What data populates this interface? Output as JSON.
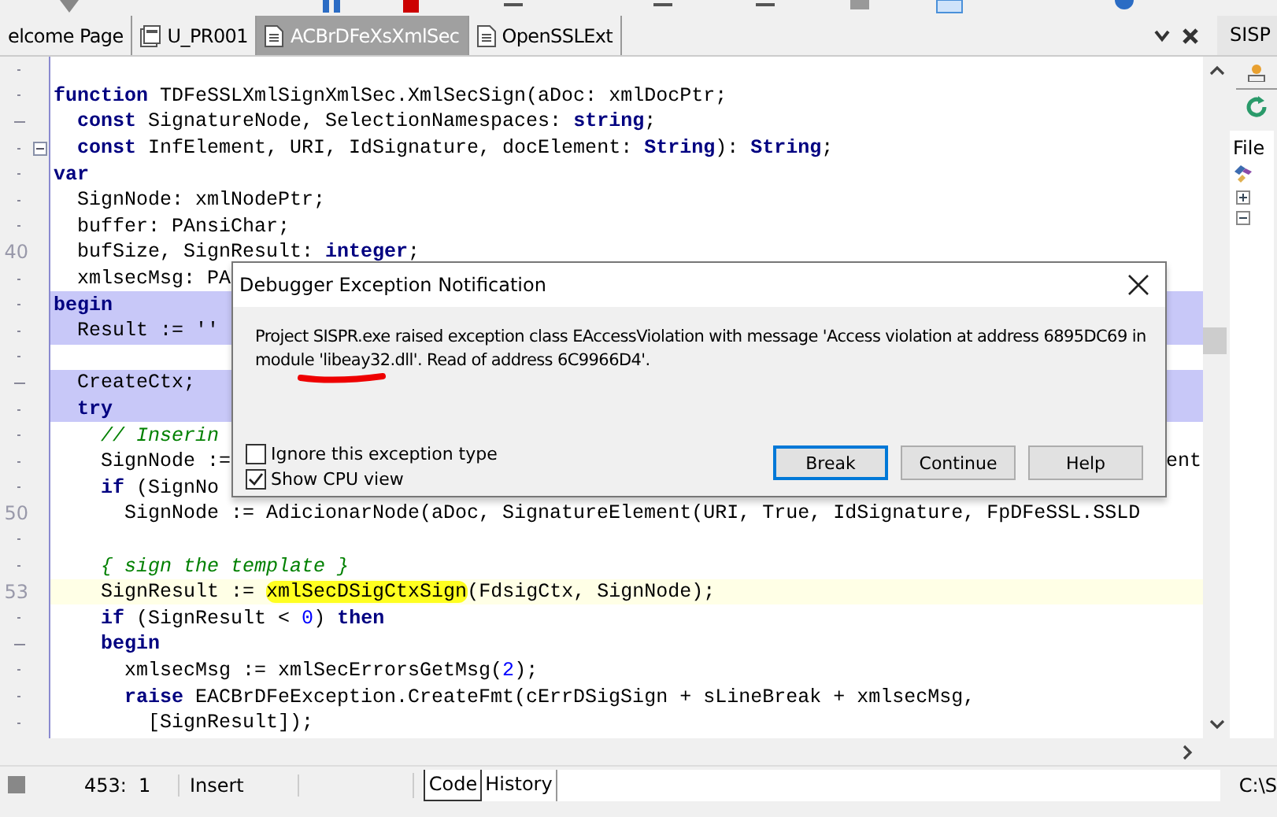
{
  "editor_tabs": [
    {
      "label": "elcome Page",
      "kind": "plain",
      "selected": false
    },
    {
      "label": "U_PR001",
      "kind": "form",
      "selected": false
    },
    {
      "label": "ACBrDFeXsXmlSec",
      "kind": "unit",
      "selected": true
    },
    {
      "label": "OpenSSLExt",
      "kind": "unit",
      "selected": false
    }
  ],
  "side_panel": {
    "title": "SISP",
    "tab_label": "File"
  },
  "code_lines": [
    {
      "gutter": {
        "kind": "dot"
      },
      "fold_box": false,
      "highlighted": false,
      "current": false
    },
    {
      "gutter": {
        "kind": "dot"
      },
      "fold_box": false,
      "highlighted": false,
      "current": false,
      "segments": [
        {
          "kind": "kw",
          "text": "function"
        },
        {
          "kind": "text",
          "text": " TDFeSSLXmlSignXmlSec.XmlSecSign(aDoc: xmlDocPtr;"
        }
      ]
    },
    {
      "gutter": {
        "kind": "dash"
      },
      "fold_box": false,
      "highlighted": false,
      "current": false,
      "segments": [
        {
          "kind": "kw",
          "text": "  const"
        },
        {
          "kind": "text",
          "text": " SignatureNode, SelectionNamespaces: "
        },
        {
          "kind": "kw",
          "text": "string"
        },
        {
          "kind": "text",
          "text": ";"
        }
      ]
    },
    {
      "gutter": {
        "kind": "dot"
      },
      "fold_box": true,
      "highlighted": false,
      "current": false,
      "segments": [
        {
          "kind": "kw",
          "text": "  const"
        },
        {
          "kind": "text",
          "text": " InfElement, URI, IdSignature, docElement: "
        },
        {
          "kind": "kw",
          "text": "String"
        },
        {
          "kind": "text",
          "text": "): "
        },
        {
          "kind": "kw",
          "text": "String"
        },
        {
          "kind": "text",
          "text": ";"
        }
      ]
    },
    {
      "gutter": {
        "kind": "dot"
      },
      "fold_box": false,
      "highlighted": false,
      "current": false,
      "segments": [
        {
          "kind": "kw",
          "text": "var"
        }
      ]
    },
    {
      "gutter": {
        "kind": "dot"
      },
      "fold_box": false,
      "highlighted": false,
      "current": false,
      "segments": [
        {
          "kind": "text",
          "text": "  SignNode: xmlNodePtr;"
        }
      ]
    },
    {
      "gutter": {
        "kind": "dot"
      },
      "fold_box": false,
      "highlighted": false,
      "current": false,
      "segments": [
        {
          "kind": "text",
          "text": "  buffer: PAnsiChar;"
        }
      ]
    },
    {
      "gutter": {
        "kind": "number",
        "text": "40"
      },
      "fold_box": false,
      "highlighted": false,
      "current": false,
      "segments": [
        {
          "kind": "text",
          "text": "  bufSize, SignResult: "
        },
        {
          "kind": "kw",
          "text": "integer"
        },
        {
          "kind": "text",
          "text": ";"
        }
      ]
    },
    {
      "gutter": {
        "kind": "dot"
      },
      "fold_box": false,
      "highlighted": false,
      "current": false,
      "segments": [
        {
          "kind": "text",
          "text": "  xmlsecMsg: PA"
        }
      ]
    },
    {
      "gutter": {
        "kind": "dot"
      },
      "fold_box": false,
      "highlighted": true,
      "current": false,
      "segments": [
        {
          "kind": "kw",
          "text": "begin"
        }
      ]
    },
    {
      "gutter": {
        "kind": "dot"
      },
      "fold_box": false,
      "highlighted": true,
      "current": false,
      "segments": [
        {
          "kind": "text",
          "text": "  Result := ''"
        }
      ]
    },
    {
      "gutter": {
        "kind": "dot"
      },
      "fold_box": false,
      "highlighted": false,
      "current": false
    },
    {
      "gutter": {
        "kind": "dash"
      },
      "fold_box": false,
      "highlighted": true,
      "current": false,
      "segments": [
        {
          "kind": "text",
          "text": "  CreateCtx;"
        }
      ]
    },
    {
      "gutter": {
        "kind": "dot"
      },
      "fold_box": false,
      "highlighted": true,
      "current": false,
      "segments": [
        {
          "kind": "kw",
          "text": "  try"
        }
      ]
    },
    {
      "gutter": {
        "kind": "dot"
      },
      "fold_box": false,
      "highlighted": false,
      "current": false,
      "segments": [
        {
          "kind": "comment",
          "text": "    // Inserin"
        }
      ]
    },
    {
      "gutter": {
        "kind": "dot"
      },
      "fold_box": false,
      "highlighted": false,
      "current": false,
      "tail": "ent",
      "segments": [
        {
          "kind": "text",
          "text": "    SignNode :="
        }
      ]
    },
    {
      "gutter": {
        "kind": "dot"
      },
      "fold_box": false,
      "highlighted": false,
      "current": false,
      "segments": [
        {
          "kind": "kw",
          "text": "    if"
        },
        {
          "kind": "text",
          "text": " (SignNo"
        }
      ]
    },
    {
      "gutter": {
        "kind": "number",
        "text": "50"
      },
      "fold_box": false,
      "highlighted": false,
      "current": false,
      "segments": [
        {
          "kind": "text",
          "text": "      SignNode := AdicionarNode(aDoc, SignatureElement(URI, True, IdSignature, FpDFeSSL.SSLD"
        }
      ]
    },
    {
      "gutter": {
        "kind": "dot"
      },
      "fold_box": false,
      "highlighted": false,
      "current": false
    },
    {
      "gutter": {
        "kind": "dot"
      },
      "fold_box": false,
      "highlighted": false,
      "current": false,
      "segments": [
        {
          "kind": "comment",
          "text": "    { sign the template }"
        }
      ]
    },
    {
      "gutter": {
        "kind": "number",
        "text": "53"
      },
      "fold_box": false,
      "highlighted": false,
      "current": true,
      "segments": [
        {
          "kind": "text",
          "text": "    SignResult := "
        },
        {
          "kind": "marked",
          "text": "xmlSecDSigCtxSign"
        },
        {
          "kind": "text",
          "text": "(FdsigCtx, SignNode);"
        }
      ]
    },
    {
      "gutter": {
        "kind": "dot"
      },
      "fold_box": false,
      "highlighted": false,
      "current": false,
      "segments": [
        {
          "kind": "kw",
          "text": "    if"
        },
        {
          "kind": "text",
          "text": " (SignResult < "
        },
        {
          "kind": "num",
          "text": "0"
        },
        {
          "kind": "text",
          "text": ") "
        },
        {
          "kind": "kw",
          "text": "then"
        }
      ]
    },
    {
      "gutter": {
        "kind": "dash"
      },
      "fold_box": false,
      "highlighted": false,
      "current": false,
      "segments": [
        {
          "kind": "kw",
          "text": "    begin"
        }
      ]
    },
    {
      "gutter": {
        "kind": "dot"
      },
      "fold_box": false,
      "highlighted": false,
      "current": false,
      "segments": [
        {
          "kind": "text",
          "text": "      xmlsecMsg := xmlSecErrorsGetMsg("
        },
        {
          "kind": "num",
          "text": "2"
        },
        {
          "kind": "text",
          "text": ");"
        }
      ]
    },
    {
      "gutter": {
        "kind": "dot"
      },
      "fold_box": false,
      "highlighted": false,
      "current": false,
      "segments": [
        {
          "kind": "kw",
          "text": "      raise"
        },
        {
          "kind": "text",
          "text": " EACBrDFeException.CreateFmt(cErrDSigSign + sLineBreak + xmlsecMsg,"
        }
      ]
    },
    {
      "gutter": {
        "kind": "dot"
      },
      "fold_box": false,
      "highlighted": false,
      "current": false,
      "segments": [
        {
          "kind": "text",
          "text": "        [SignResult]);"
        }
      ]
    }
  ],
  "dialog": {
    "title": "Debugger Exception Notification",
    "message": "Project SISPR.exe raised exception class EAccessViolation with message 'Access violation at address 6895DC69 in module 'libeay32.dll'. Read of address 6C9966D4'.",
    "checkboxes": [
      {
        "label": "Ignore this exception type",
        "checked": false
      },
      {
        "label": "Show CPU view",
        "checked": true
      }
    ],
    "buttons": [
      {
        "label": "Break",
        "default": true
      },
      {
        "label": "Continue",
        "default": false
      },
      {
        "label": "Help",
        "default": false
      }
    ]
  },
  "status_bar": {
    "position": "453:  1",
    "mode": "Insert",
    "view_tabs": [
      {
        "label": "Code",
        "selected": true
      },
      {
        "label": "History",
        "selected": false
      }
    ],
    "path": "C:\\S"
  }
}
